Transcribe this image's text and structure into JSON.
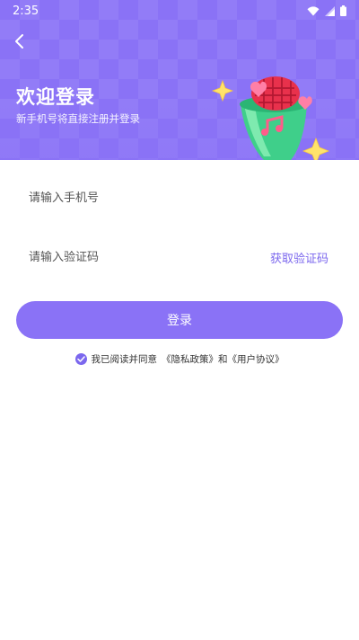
{
  "status_bar": {
    "time": "2:35"
  },
  "header": {
    "title": "欢迎登录",
    "subtitle": "新手机号将直接注册并登录"
  },
  "form": {
    "phone_placeholder": "请输入手机号",
    "code_placeholder": "请输入验证码",
    "get_code_label": "获取验证码",
    "login_label": "登录"
  },
  "agreement": {
    "prefix": "我已阅读并同意",
    "privacy_link": "《隐私政策》",
    "conjunction": "和",
    "terms_link": "《用户协议》",
    "checked": true
  },
  "colors": {
    "accent": "#8a72f6",
    "link": "#7b67ee"
  },
  "icons": [
    "wifi-icon",
    "signal-icon",
    "battery-icon",
    "back-arrow-icon",
    "checkmark-icon",
    "microphone-illustration",
    "sparkle-star-icon",
    "heart-icon",
    "music-note-icon"
  ]
}
